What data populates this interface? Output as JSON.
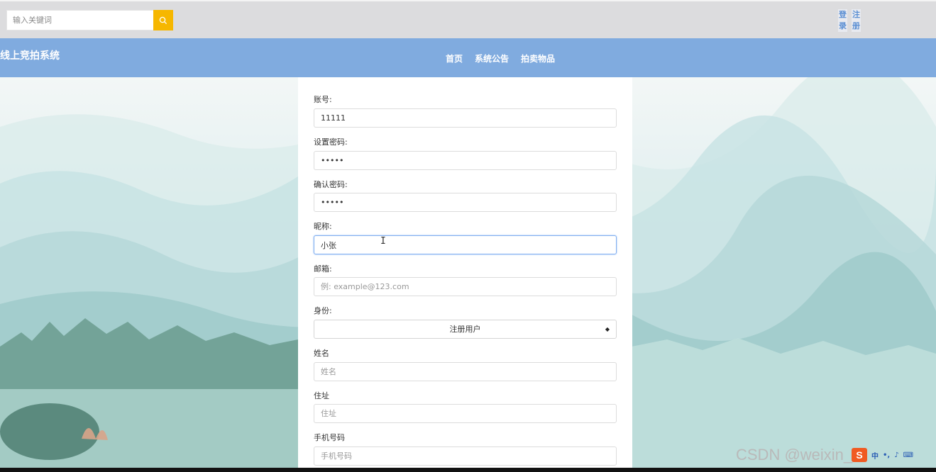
{
  "search": {
    "placeholder": "输入关键词"
  },
  "auth": {
    "login": "登录",
    "register": "注册"
  },
  "brand": "线上竞拍系统",
  "nav": [
    "首页",
    "系统公告",
    "拍卖物品"
  ],
  "form": {
    "account_label": "账号:",
    "account_value": "11111",
    "password_label": "设置密码:",
    "password_value": "11111",
    "confirm_label": "确认密码:",
    "confirm_value": "11111",
    "nickname_label": "昵称:",
    "nickname_value": "小张",
    "email_label": "邮箱:",
    "email_placeholder": "例: example@123.com",
    "role_label": "身份:",
    "role_value": "注册用户",
    "name_label": "姓名",
    "name_placeholder": "姓名",
    "address_label": "住址",
    "address_placeholder": "住址",
    "phone_label": "手机号码",
    "phone_placeholder": "手机号码"
  },
  "watermark": "CSDN @weixin_",
  "colors": {
    "nav_bg": "#80abdf",
    "search_btn": "#f6b700",
    "topbar_bg": "#dcdcde"
  }
}
